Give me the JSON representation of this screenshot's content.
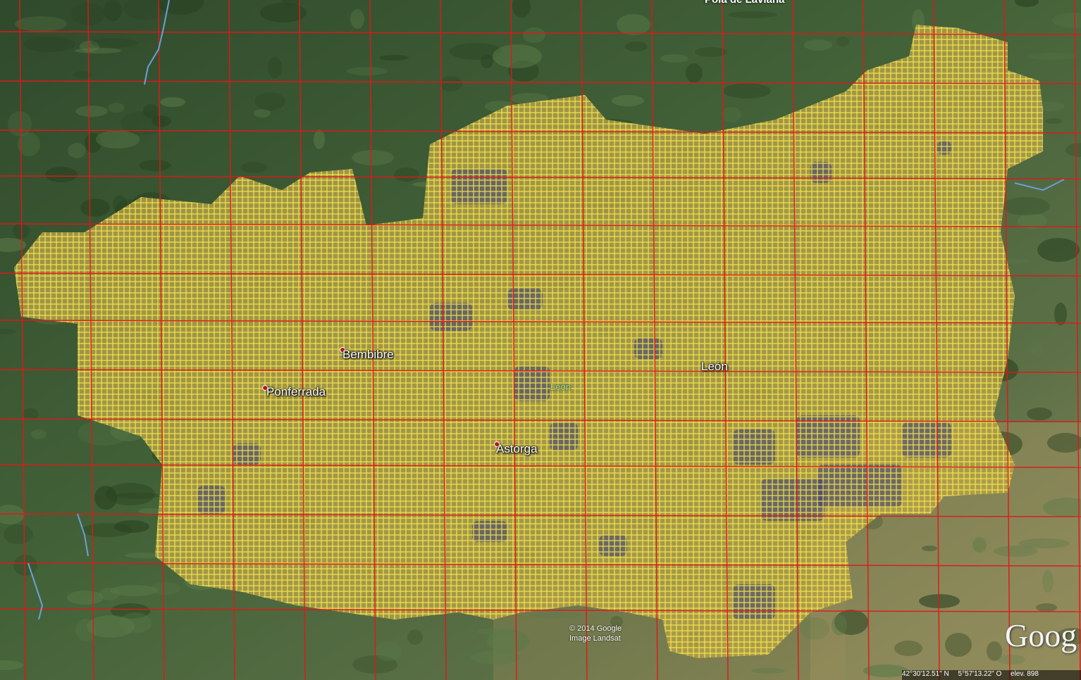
{
  "map": {
    "top_label": "Pola de Laviana",
    "region_label": "León",
    "cities": [
      {
        "name": "Bembibre"
      },
      {
        "name": "Ponferrada"
      },
      {
        "name": "León"
      },
      {
        "name": "Astorga"
      }
    ],
    "attribution": {
      "line1": "© 2014 Google",
      "line2": "Image Landsat"
    },
    "logo": "Goog",
    "status": {
      "latitude": "42°30'12.51\" N",
      "longitude": "5°57'13.22\" O",
      "elevation": "elev.  898"
    },
    "colors": {
      "terrain_dark": "#2f4a2c",
      "terrain_mid": "#4a6a3e",
      "plain": "#8a8a5a",
      "red_grid": "#e01818",
      "yellow_grid": "#ffeb4a",
      "overlay_fill": "#b5a24a",
      "water_patch": "#3a3f7a"
    },
    "icons": {
      "city_marker": "red-dot-icon"
    }
  }
}
